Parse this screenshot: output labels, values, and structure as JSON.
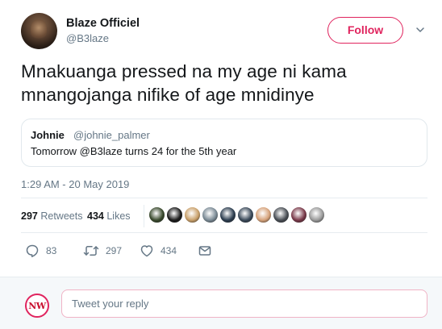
{
  "author": {
    "name": "Blaze Officiel",
    "handle": "@B3laze",
    "follow_label": "Follow"
  },
  "tweet": {
    "text": "Mnakuanga pressed na my age ni kama mnangojanga nifike of age mnidinye",
    "timestamp": "1:29 AM - 20 May 2019"
  },
  "quoted_tweet": {
    "name": "Johnie",
    "handle": "@johnie_palmer",
    "text": "Tomorrow @B3laze turns 24 for the 5th year"
  },
  "stats": {
    "retweets_count": "297",
    "retweets_label": "Retweets",
    "likes_count": "434",
    "likes_label": "Likes"
  },
  "likers": [
    {
      "icon": "liker-avatar",
      "color": "#3a4a2e"
    },
    {
      "icon": "liker-avatar",
      "color": "#1c1c1c"
    },
    {
      "icon": "liker-avatar",
      "color": "#c9a06a"
    },
    {
      "icon": "liker-avatar",
      "color": "#7a8a95"
    },
    {
      "icon": "liker-avatar",
      "color": "#2d3e50"
    },
    {
      "icon": "liker-avatar",
      "color": "#3b4a5a"
    },
    {
      "icon": "liker-avatar",
      "color": "#d6a27a"
    },
    {
      "icon": "liker-avatar",
      "color": "#4a4f55"
    },
    {
      "icon": "liker-avatar",
      "color": "#7a3a4a"
    },
    {
      "icon": "liker-avatar",
      "color": "#9a9a9a"
    }
  ],
  "actions": {
    "reply_count": "83",
    "retweet_count": "297",
    "like_count": "434"
  },
  "reply_box": {
    "placeholder": "Tweet your reply",
    "avatar_text": "NW"
  },
  "colors": {
    "accent": "#e0245e",
    "muted": "#657786",
    "text": "#14171a",
    "border": "#e1e8ed"
  }
}
